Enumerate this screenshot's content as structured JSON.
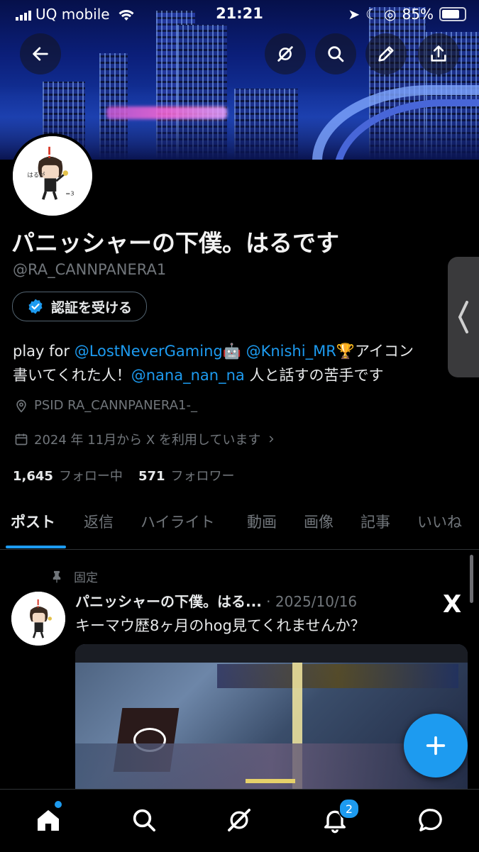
{
  "status_bar": {
    "carrier": "UQ mobile",
    "time": "21:21",
    "battery": "85%"
  },
  "header": {
    "back_icon": "arrow-left-icon",
    "grok_icon": "grok-icon",
    "search_icon": "search-icon",
    "edit_icon": "pencil-icon",
    "share_icon": "share-icon"
  },
  "profile": {
    "name": "パニッシャーの下僕。はるです",
    "handle": "@RA_CANNPANERA1",
    "verify_label": "認証を受ける",
    "bio": {
      "prefix": "play for ",
      "link1": "@LostNeverGaming",
      "emoji1": "🤖",
      "space": " ",
      "link2": "@Knishi_MR",
      "emoji2": "🏆",
      "mid": "アイコン",
      "line2_prefix": "書いてくれた人！",
      "link3": "@nana_nan_na",
      "line2_suffix": " 人と話すの苦手です"
    },
    "location": "PSID RA_CANNPANERA1-_",
    "joined": "2024 年 11月から X を利用しています",
    "following_count": "1,645",
    "following_label": "フォロー中",
    "followers_count": "571",
    "followers_label": "フォロワー"
  },
  "tabs": [
    "ポスト",
    "返信",
    "ハイライト",
    "動画",
    "画像",
    "記事",
    "いいね"
  ],
  "post": {
    "pinned_label": "固定",
    "author": "パニッシャーの下僕。はる...",
    "separator": " · ",
    "date": "2025/10/16",
    "text": "キーマウ歴8ヶ月のhog見てくれませんか？",
    "source_logo": "X"
  },
  "fab_icon": "plus-icon",
  "bottom_nav": {
    "items": [
      "home-icon",
      "search-icon",
      "grok-icon",
      "bell-icon",
      "messages-icon"
    ],
    "notifications_badge": "2"
  },
  "colors": {
    "accent": "#1d9bf0",
    "background": "#000000",
    "secondary_text": "#71767b"
  }
}
